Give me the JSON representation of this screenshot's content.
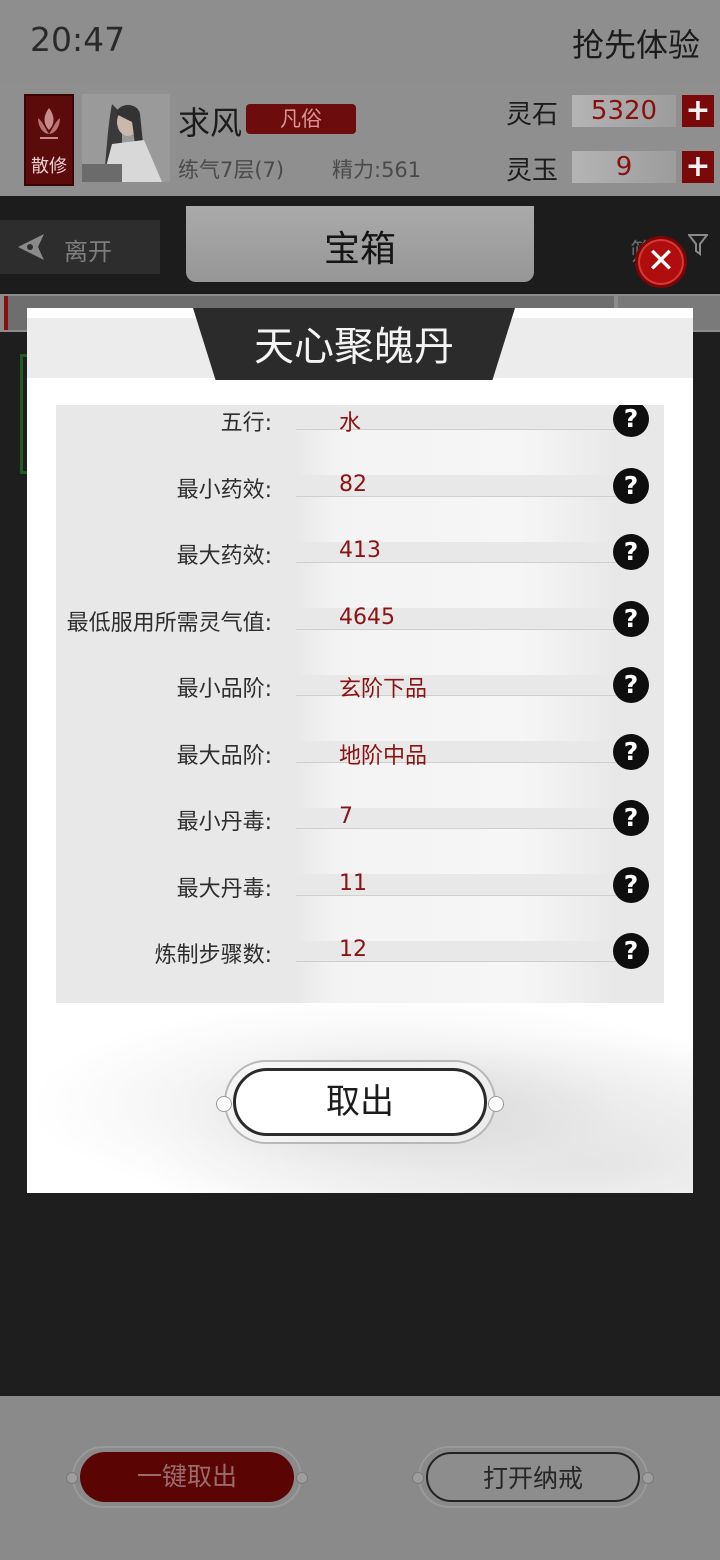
{
  "status_bar": {
    "time": "20:47",
    "right_text": "抢先体验"
  },
  "player": {
    "sect_label": "散修",
    "name": "求风",
    "rank": "凡俗",
    "cultivation": "练气7层(7)",
    "energy": "精力:561"
  },
  "resources": [
    {
      "label": "灵石",
      "value": "5320",
      "plus": "+"
    },
    {
      "label": "灵玉",
      "value": "9",
      "plus": "+"
    }
  ],
  "tab_bar": {
    "leave_label": "离开",
    "title": "宝箱",
    "filter_label": "筛"
  },
  "modal": {
    "title": "天心聚魄丹",
    "close_symbol": "✕",
    "help_symbol": "?",
    "properties": [
      {
        "label": "五行:",
        "value": "水"
      },
      {
        "label": "最小药效:",
        "value": "82"
      },
      {
        "label": "最大药效:",
        "value": "413"
      },
      {
        "label": "最低服用所需灵气值:",
        "value": "4645"
      },
      {
        "label": "最小品阶:",
        "value": "玄阶下品"
      },
      {
        "label": "最大品阶:",
        "value": "地阶中品"
      },
      {
        "label": "最小丹毒:",
        "value": "7"
      },
      {
        "label": "最大丹毒:",
        "value": "11"
      },
      {
        "label": "炼制步骤数:",
        "value": "12"
      }
    ],
    "take_out_label": "取出"
  },
  "bottom_bar": {
    "take_all_label": "一键取出",
    "open_ring_label": "打开纳戒"
  },
  "colors": {
    "accent_red": "#8b1212",
    "close_red": "#b00e0e",
    "modal_title_bg": "#2b2b2b"
  }
}
